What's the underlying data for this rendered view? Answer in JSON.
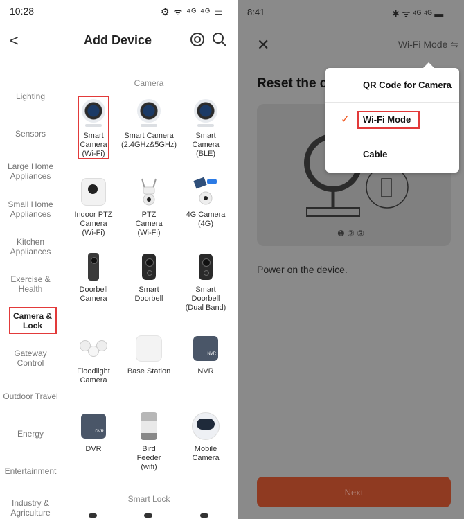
{
  "left": {
    "status": {
      "time": "10:28",
      "icons": "⚙ ᯤ ⁴ᴳ ⁴ᴳ ▭"
    },
    "header": {
      "back": "<",
      "title": "Add Device"
    },
    "categories": [
      {
        "label": "Lighting"
      },
      {
        "label": "Sensors"
      },
      {
        "label": "Large Home Appliances"
      },
      {
        "label": "Small Home Appliances"
      },
      {
        "label": "Kitchen Appliances"
      },
      {
        "label": "Exercise & Health"
      },
      {
        "label": "Camera & Lock"
      },
      {
        "label": "Gateway Control"
      },
      {
        "label": "Outdoor Travel"
      },
      {
        "label": "Energy"
      },
      {
        "label": "Entertainment"
      },
      {
        "label": "Industry & Agriculture"
      }
    ],
    "sections": {
      "camera": "Camera",
      "smart_lock": "Smart Lock"
    },
    "items": [
      {
        "label": "Smart Camera (Wi-Fi)"
      },
      {
        "label": "Smart Camera (2.4GHz&5GHz)"
      },
      {
        "label": "Smart Camera (BLE)"
      },
      {
        "label": "Indoor PTZ Camera (Wi-Fi)"
      },
      {
        "label": "PTZ Camera (Wi-Fi)"
      },
      {
        "label": "4G Camera (4G)"
      },
      {
        "label": "Doorbell Camera"
      },
      {
        "label": "Smart Doorbell"
      },
      {
        "label": "Smart Doorbell (Dual Band)"
      },
      {
        "label": "Floodlight Camera"
      },
      {
        "label": "Base Station"
      },
      {
        "label": "NVR"
      },
      {
        "label": "DVR"
      },
      {
        "label": "Bird Feeder (wifi)"
      },
      {
        "label": "Mobile Camera"
      }
    ],
    "badges": {
      "nvr": "NVR",
      "dvr": "DVR"
    }
  },
  "right": {
    "status": {
      "time": "8:41",
      "icons": "✱ ᯤ ⁴ᴳ ⁴ᴳ ▬"
    },
    "header": {
      "close": "✕",
      "mode": "Wi-Fi Mode ⇋"
    },
    "heading": "Reset the c",
    "carousel_dots": "❶ ② ③",
    "instruction": "Power on the device.",
    "next_label": "Next",
    "menu": [
      {
        "label": "QR Code for Camera"
      },
      {
        "label": "Wi-Fi Mode",
        "check": "✓"
      },
      {
        "label": "Cable"
      }
    ]
  },
  "colors": {
    "accent": "#f05a24",
    "highlight_box": "#e23a3a"
  }
}
